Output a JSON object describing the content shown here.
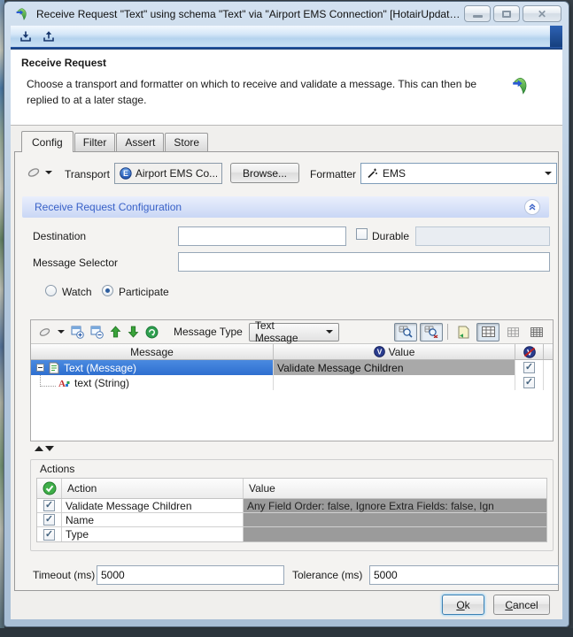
{
  "window": {
    "title": "Receive Request \"Text\" using schema \"Text\" via \"Airport EMS Connection\" [HotairUpdate/RV..."
  },
  "header": {
    "title": "Receive Request",
    "description": "Choose a transport and formatter on which to receive and validate a message. This can then be replied to at a later stage."
  },
  "tabs": [
    {
      "label": "Config"
    },
    {
      "label": "Filter"
    },
    {
      "label": "Assert"
    },
    {
      "label": "Store"
    }
  ],
  "transport": {
    "label": "Transport",
    "value": "Airport EMS Co...",
    "browse": "Browse...",
    "formatter_label": "Formatter",
    "formatter_value": "EMS"
  },
  "config": {
    "section_title": "Receive Request Configuration",
    "destination_label": "Destination",
    "durable_label": "Durable",
    "message_selector_label": "Message Selector",
    "watch_label": "Watch",
    "participate_label": "Participate"
  },
  "editor": {
    "message_type_label": "Message Type",
    "message_type_value": "Text Message",
    "col_message": "Message",
    "col_value": "Value",
    "rows": [
      {
        "name": "Text (Message)",
        "value": "Validate Message Children",
        "checked": true,
        "selected": true
      },
      {
        "name": "text (String)",
        "value": "",
        "checked": true,
        "selected": false
      }
    ]
  },
  "actions": {
    "title": "Actions",
    "col_action": "Action",
    "col_value": "Value",
    "rows": [
      {
        "action": "Validate Message Children",
        "value": "Any Field Order: false, Ignore Extra Fields: false, Ign",
        "checked": true
      },
      {
        "action": "Name",
        "value": "",
        "checked": true
      },
      {
        "action": "Type",
        "value": "",
        "checked": true
      }
    ]
  },
  "footer": {
    "timeout_label": "Timeout (ms)",
    "timeout_value": "5000",
    "tolerance_label": "Tolerance (ms)",
    "tolerance_value": "5000",
    "ok_first": "O",
    "ok_rest": "k",
    "cancel_first": "C",
    "cancel_rest": "ancel"
  },
  "icons": {
    "transport_e": "E",
    "value_v": "V",
    "novalidate_v": "V"
  },
  "colors": {
    "selection_blue": "#2e6fd0",
    "section_text_blue": "#3a62c8",
    "toolbar_dark_blue": "#16407e",
    "value_cell_gray": "#a9a9a9",
    "actions_cell_gray": "#9b9b9b"
  }
}
